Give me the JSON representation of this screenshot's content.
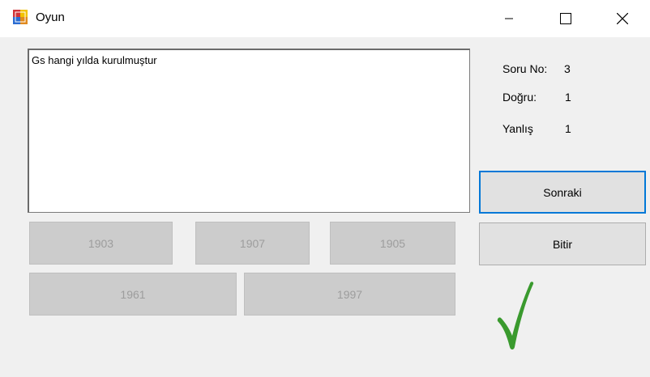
{
  "window": {
    "title": "Oyun"
  },
  "question": {
    "text": "Gs hangi yılda kurulmuştur"
  },
  "answers": [
    "1903",
    "1907",
    "1905",
    "1961",
    "1997"
  ],
  "stats": {
    "question_no_label": "Soru No:",
    "question_no_value": "3",
    "correct_label": "Doğru:",
    "correct_value": "1",
    "wrong_label": "Yanlış",
    "wrong_value": "1"
  },
  "buttons": {
    "next_label": "Sonraki",
    "finish_label": "Bitir"
  },
  "feedback": {
    "icon": "checkmark-icon",
    "color": "#3a9a2e"
  }
}
